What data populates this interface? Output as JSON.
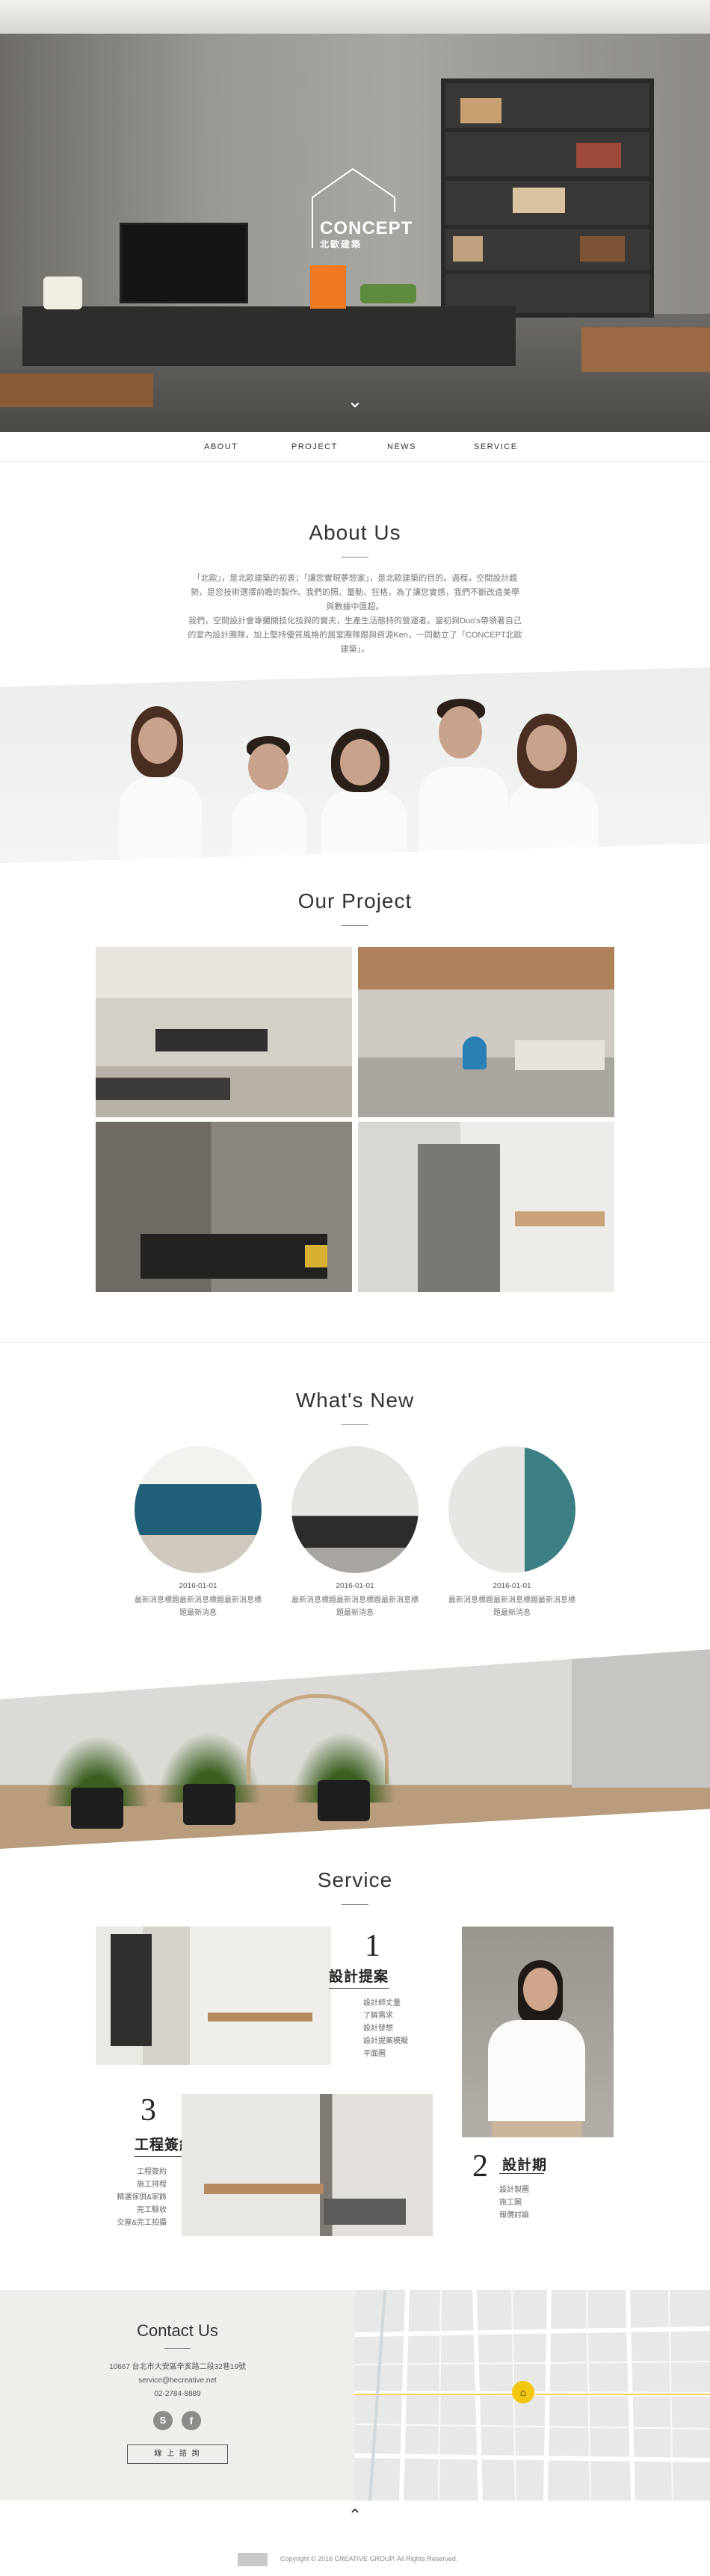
{
  "hero": {
    "brand": "CONCEPT",
    "brand_sub": "北歐建築",
    "scroll_icon": "chevron-down-icon"
  },
  "nav": {
    "items": [
      "ABOUT",
      "PROJECT",
      "NEWS",
      "SERVICE"
    ]
  },
  "about": {
    "title": "About Us",
    "p1": "「北歐」，是北歐建築的初衷；「讓您實現夢想家」，是北歐建築的目的。過程，空間設計趨勢，是您技術選擇前瞻的製作。我們的照、量動、狂格，為了讓您實感，我們不斷改造美學與數據中匯超。",
    "p2": "我們，空間設計會專攤開技化技與的實夫，生產生活態持的營運者。當初與Duo's帶領著自己的室內設計團隊，加上堅持優質風格的居室團隊跟與資源Ken，一同動立了「CONCEPT北歐建築」。"
  },
  "project": {
    "title": "Our Project"
  },
  "news": {
    "title": "What's New",
    "items": [
      {
        "date": "2016-01-01",
        "text": "最新消息標題最新消息標題最新消息標題最新消息"
      },
      {
        "date": "2016-01-01",
        "text": "最新消息標題最新消息標題最新消息標題最新消息"
      },
      {
        "date": "2016-01-01",
        "text": "最新消息標題最新消息標題最新消息標題最新消息"
      }
    ]
  },
  "service": {
    "title": "Service",
    "s1": {
      "num": "1",
      "title": "設計提案",
      "list": [
        "設計師丈量",
        "了解需求",
        "設計發想",
        "設計提案模擬",
        "平面圖"
      ]
    },
    "s2": {
      "num": "2",
      "title": "設計期",
      "list": [
        "設計製圖",
        "施工圖",
        "報價討論"
      ]
    },
    "s3": {
      "num": "3",
      "title": "工程簽約",
      "list": [
        "工程簽約",
        "施工排程",
        "精選傢俱&家飾",
        "完工驗收",
        "交屋&完工拍攝"
      ]
    }
  },
  "contact": {
    "title": "Contact Us",
    "address": "10667 台北市大安區辛亥路二段32巷19號",
    "email": "service@hecreative.net",
    "phone": "02-2784-8889",
    "icons": [
      "skype-icon",
      "facebook-icon"
    ],
    "button": "線 上 諮 詢"
  },
  "footer": {
    "copyright": "Copyright © 2016 CREATIVE GROUP. All Rights Reserved.",
    "top_icon": "chevron-up-icon"
  },
  "colors": {
    "accent": "#f3c70f",
    "footer_bg": "#efeeea",
    "text": "#333333"
  }
}
